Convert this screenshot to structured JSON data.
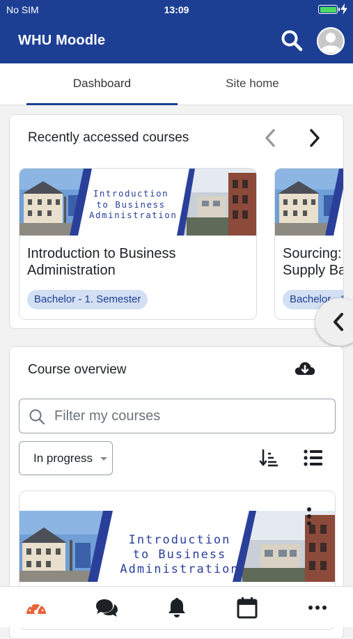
{
  "status_bar": {
    "carrier": "No SIM",
    "time": "13:09"
  },
  "app_bar": {
    "title": "WHU Moodle"
  },
  "tabs": [
    {
      "label": "Dashboard",
      "active": true
    },
    {
      "label": "Site home",
      "active": false
    }
  ],
  "recent": {
    "title": "Recently accessed courses",
    "courses": [
      {
        "name": "Introduction to Business Administration",
        "badge": "Bachelor - 1. Semester",
        "banner_text": [
          "Introduction",
          "to Business",
          "Administration"
        ]
      },
      {
        "name": "Sourcing: Supply Ba",
        "badge": "Bachelor - 1.",
        "name_lines": [
          "Sourcing:",
          "Supply Ba"
        ]
      }
    ]
  },
  "overview": {
    "title": "Course overview",
    "filter_placeholder": "Filter my courses",
    "progress_value": "In progress",
    "first_course_banner_text": [
      "Introduction",
      "to Business",
      "Administration"
    ]
  },
  "bottom_nav": [
    "dashboard-icon",
    "messages-icon",
    "notifications-icon",
    "calendar-icon",
    "more-icon"
  ],
  "colors": {
    "primary": "#1c3f94",
    "badge_bg": "#d3dff2",
    "dashboard_active": "#e8623a",
    "battery": "#4cd964"
  }
}
